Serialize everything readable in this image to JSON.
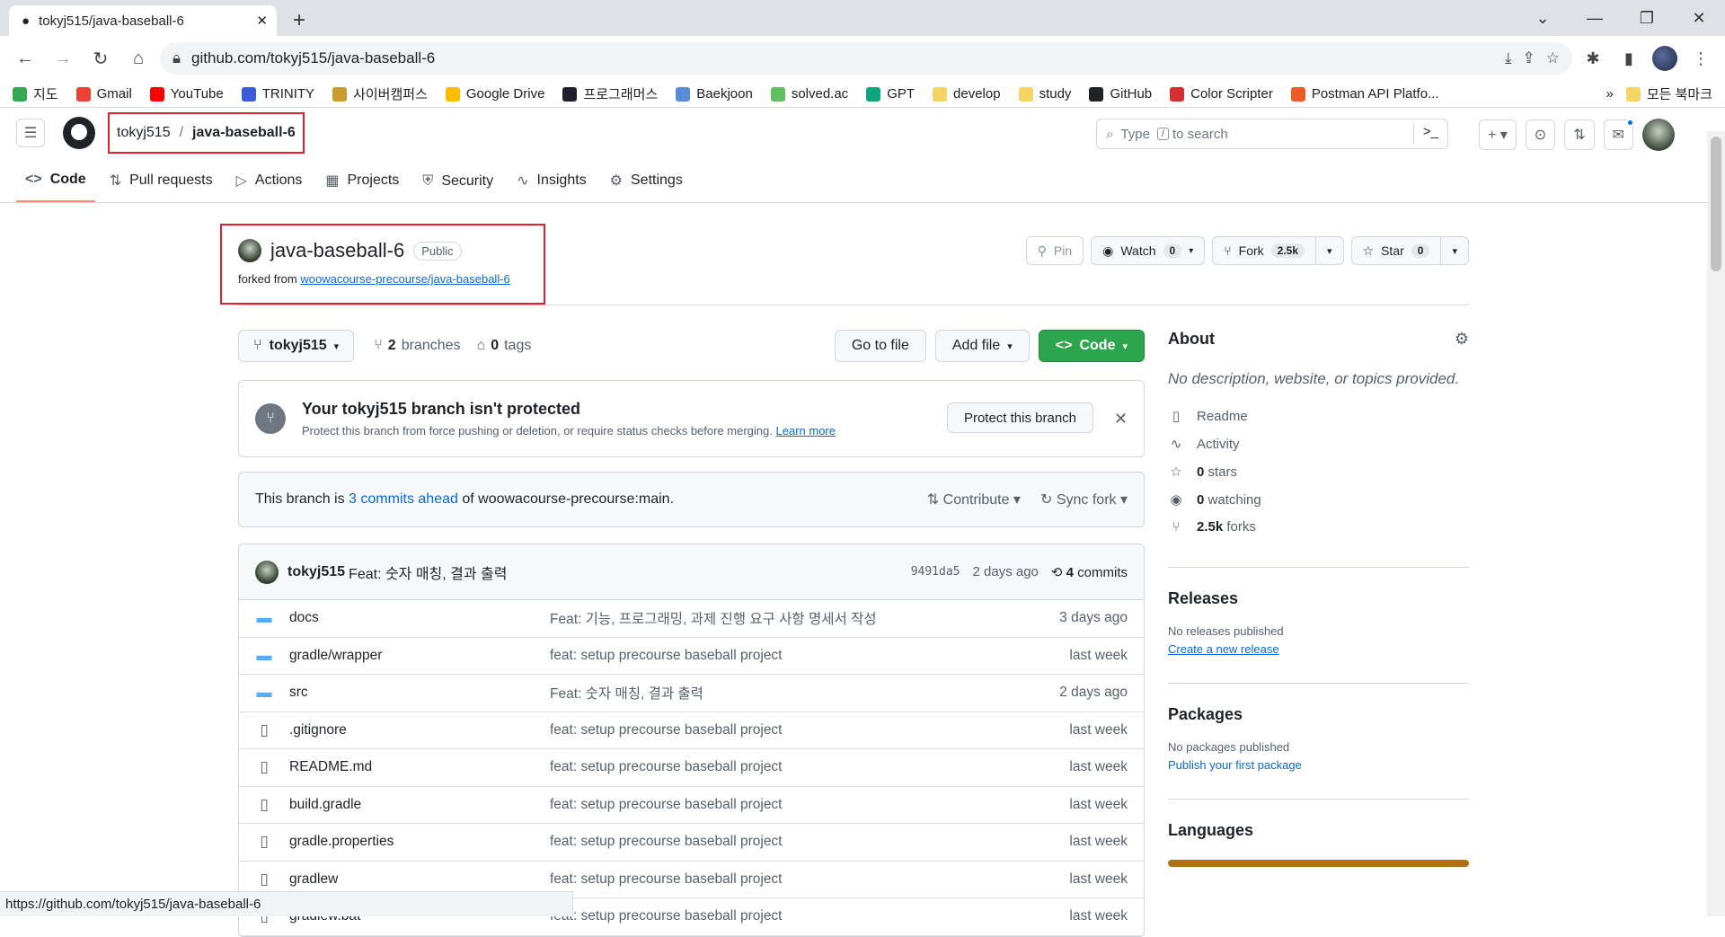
{
  "browser": {
    "tab_title": "tokyj515/java-baseball-6",
    "url": "github.com/tokyj515/java-baseball-6",
    "bookmarks": [
      {
        "label": "지도",
        "color": "#34a853"
      },
      {
        "label": "Gmail",
        "color": "#ea4335"
      },
      {
        "label": "YouTube",
        "color": "#ff0000"
      },
      {
        "label": "TRINITY",
        "color": "#3b5bdb"
      },
      {
        "label": "사이버캠퍼스",
        "color": "#c99a2e"
      },
      {
        "label": "Google Drive",
        "color": "#fbbc04"
      },
      {
        "label": "프로그래머스",
        "color": "#1e1e2e"
      },
      {
        "label": "Baekjoon",
        "color": "#5a8bd8"
      },
      {
        "label": "solved.ac",
        "color": "#60c060"
      },
      {
        "label": "GPT",
        "color": "#10a37f"
      },
      {
        "label": "develop",
        "color": "#f6d365"
      },
      {
        "label": "study",
        "color": "#f6d365"
      },
      {
        "label": "GitHub",
        "color": "#1f2328"
      },
      {
        "label": "Color Scripter",
        "color": "#d32f2f"
      },
      {
        "label": "Postman API Platfo...",
        "color": "#ef5b25"
      }
    ],
    "more": "»",
    "all_bookmarks": "모든 북마크",
    "status_url": "https://github.com/tokyj515/java-baseball-6"
  },
  "header": {
    "owner": "tokyj515",
    "sep": "/",
    "repo": "java-baseball-6",
    "search_pre": "Type",
    "search_key": "/",
    "search_post": "to search"
  },
  "nav": {
    "tabs": [
      "Code",
      "Pull requests",
      "Actions",
      "Projects",
      "Security",
      "Insights",
      "Settings"
    ]
  },
  "repo": {
    "title": "java-baseball-6",
    "visibility": "Public",
    "forked_prefix": "forked from",
    "forked_link": "woowacourse-precourse/java-baseball-6",
    "pin": "Pin",
    "watch": "Watch",
    "watch_count": "0",
    "fork": "Fork",
    "fork_count": "2.5k",
    "star": "Star",
    "star_count": "0"
  },
  "toolbar": {
    "branch": "tokyj515",
    "branches_count": "2",
    "branches_label": "branches",
    "tags_count": "0",
    "tags_label": "tags",
    "go_to_file": "Go to file",
    "add_file": "Add file",
    "code": "Code"
  },
  "flash": {
    "title": "Your tokyj515 branch isn't protected",
    "body": "Protect this branch from force pushing or deletion, or require status checks before merging.",
    "learn_more": "Learn more",
    "button": "Protect this branch"
  },
  "ahead": {
    "pre": "This branch is",
    "link": "3 commits ahead",
    "post": "of woowacourse-precourse:main.",
    "contribute": "Contribute",
    "sync": "Sync fork"
  },
  "commit": {
    "author": "tokyj515",
    "message": "Feat: 숫자 매칭, 결과 출력",
    "sha": "9491da5",
    "time": "2 days ago",
    "count": "4",
    "count_label": "commits"
  },
  "files": [
    {
      "name": "docs",
      "type": "dir",
      "msg": "Feat: 기능, 프로그래밍, 과제 진행 요구 사항 명세서 작성",
      "time": "3 days ago"
    },
    {
      "name": "gradle/wrapper",
      "type": "dir",
      "msg": "feat: setup precourse baseball project",
      "time": "last week"
    },
    {
      "name": "src",
      "type": "dir",
      "msg": "Feat: 숫자 매칭, 결과 출력",
      "time": "2 days ago"
    },
    {
      "name": ".gitignore",
      "type": "file",
      "msg": "feat: setup precourse baseball project",
      "time": "last week"
    },
    {
      "name": "README.md",
      "type": "file",
      "msg": "feat: setup precourse baseball project",
      "time": "last week"
    },
    {
      "name": "build.gradle",
      "type": "file",
      "msg": "feat: setup precourse baseball project",
      "time": "last week"
    },
    {
      "name": "gradle.properties",
      "type": "file",
      "msg": "feat: setup precourse baseball project",
      "time": "last week"
    },
    {
      "name": "gradlew",
      "type": "file",
      "msg": "feat: setup precourse baseball project",
      "time": "last week"
    },
    {
      "name": "gradlew.bat",
      "type": "file",
      "msg": "feat: setup precourse baseball project",
      "time": "last week"
    }
  ],
  "about": {
    "title": "About",
    "desc": "No description, website, or topics provided.",
    "readme": "Readme",
    "activity": "Activity",
    "stars_count": "0",
    "stars_label": "stars",
    "watching_count": "0",
    "watching_label": "watching",
    "forks_count": "2.5k",
    "forks_label": "forks"
  },
  "releases": {
    "title": "Releases",
    "none": "No releases published",
    "link": "Create a new release"
  },
  "packages": {
    "title": "Packages",
    "none": "No packages published",
    "link": "Publish your first package"
  },
  "languages": {
    "title": "Languages",
    "color": "#b07219"
  }
}
